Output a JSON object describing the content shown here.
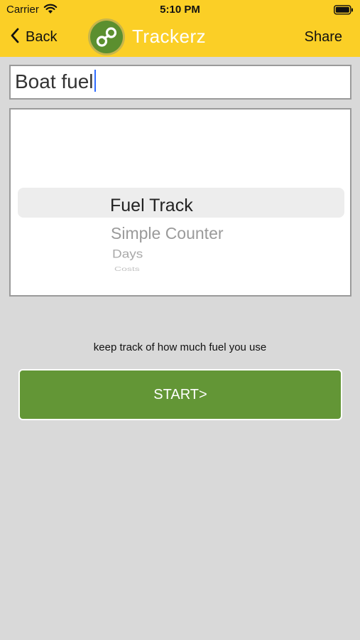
{
  "status_bar": {
    "carrier": "Carrier",
    "time": "5:10 PM",
    "icons": [
      "wifi-icon",
      "battery-icon"
    ]
  },
  "nav_bar": {
    "back_label": "Back",
    "app_title": "Trackerz",
    "share_label": "Share",
    "icons": [
      "chevron-left-icon",
      "app-logo-icon"
    ]
  },
  "name_input": {
    "value": "Boat fuel"
  },
  "tracker_picker": {
    "selected": "Fuel Track",
    "options": [
      "Fuel Track",
      "Simple Counter",
      "Days",
      "Costs"
    ]
  },
  "description": "keep track of how much fuel you use",
  "start_button": {
    "label": "START>"
  },
  "colors": {
    "header": "#fbcf26",
    "background": "#d9d9d9",
    "start_button": "#639636",
    "logo_circle": "#5b8f2f"
  }
}
